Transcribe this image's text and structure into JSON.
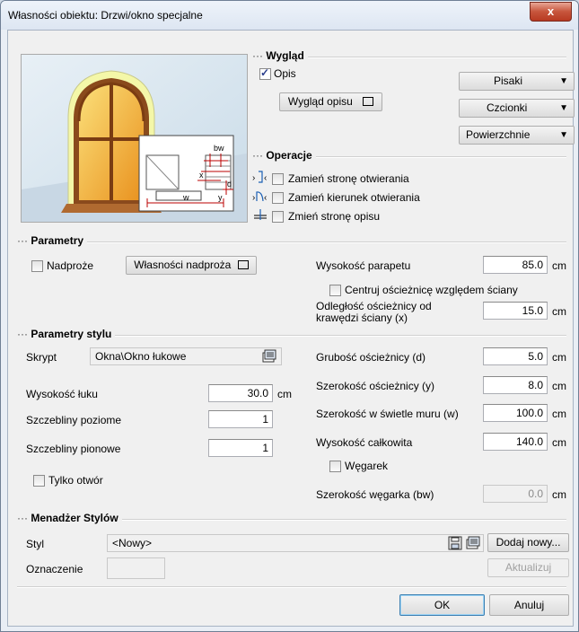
{
  "window": {
    "title": "Własności obiektu: Drzwi/okno specjalne",
    "close_symbol": "x"
  },
  "wyglad": {
    "title": "Wygląd",
    "opis_label": "Opis",
    "opis_checked": true,
    "wyglad_opisu_button": "Wygląd opisu",
    "pisaki_button": "Pisaki",
    "czcionki_button": "Czcionki",
    "powierzchnie_button": "Powierzchnie"
  },
  "preview": {
    "labels": {
      "bw": "bw",
      "x": "x",
      "d": "d",
      "w": "w",
      "y": "y"
    }
  },
  "operacje": {
    "title": "Operacje",
    "items": [
      {
        "label": "Zamień stronę otwierania",
        "checked": false
      },
      {
        "label": "Zamień kierunek otwierania",
        "checked": false
      },
      {
        "label": "Zmień stronę opisu",
        "checked": false
      }
    ]
  },
  "parametry": {
    "title": "Parametry",
    "nadproze_label": "Nadproże",
    "wlasnosci_nadproza_button": "Własności nadproża",
    "wysokosc_parapetu_label": "Wysokość parapetu",
    "wysokosc_parapetu_value": "85.0",
    "centruj_label": "Centruj ościeżnicę względem ściany",
    "odleglosc_label_1": "Odległość ościeżnicy od",
    "odleglosc_label_2": "krawędzi ściany (x)",
    "odleglosc_value": "15.0"
  },
  "parametry_stylu": {
    "title": "Parametry stylu",
    "skrypt_label": "Skrypt",
    "skrypt_value": "Okna\\Okno łukowe",
    "wysokosc_luku_label": "Wysokość łuku",
    "wysokosc_luku_value": "30.0",
    "szczebliny_poziome_label": "Szczebliny poziome",
    "szczebliny_poziome_value": "1",
    "szczebliny_pionowe_label": "Szczebliny pionowe",
    "szczebliny_pionowe_value": "1",
    "tylko_otwor_label": "Tylko otwór",
    "grubosc_label": "Grubość ościeżnicy (d)",
    "grubosc_value": "5.0",
    "szerokosc_osc_label": "Szerokość ościeżnicy (y)",
    "szerokosc_osc_value": "8.0",
    "szerokosc_swiatlo_label": "Szerokość w świetle muru (w)",
    "szerokosc_swiatlo_value": "100.0",
    "wysokosc_calkowita_label": "Wysokość całkowita",
    "wysokosc_calkowita_value": "140.0",
    "wegarek_label": "Węgarek",
    "szerokosc_wegarka_label": "Szerokość węgarka (bw)",
    "szerokosc_wegarka_value": "0.0"
  },
  "unit": "cm",
  "menadzer": {
    "title": "Menadżer Stylów",
    "styl_label": "Styl",
    "styl_value": "<Nowy>",
    "dodaj_nowy_button": "Dodaj nowy...",
    "oznaczenie_label": "Oznaczenie",
    "aktualizuj_button": "Aktualizuj"
  },
  "footer": {
    "ok_button": "OK",
    "anuluj_button": "Anuluj"
  },
  "colors": {
    "close_red": "#c7553c",
    "title_bg": "#dde6f2",
    "client_bg": "#f0f0f0",
    "wall": "#f6f9b8",
    "frame_wood": "#8a4a1c",
    "glass": "#f7b24a"
  }
}
